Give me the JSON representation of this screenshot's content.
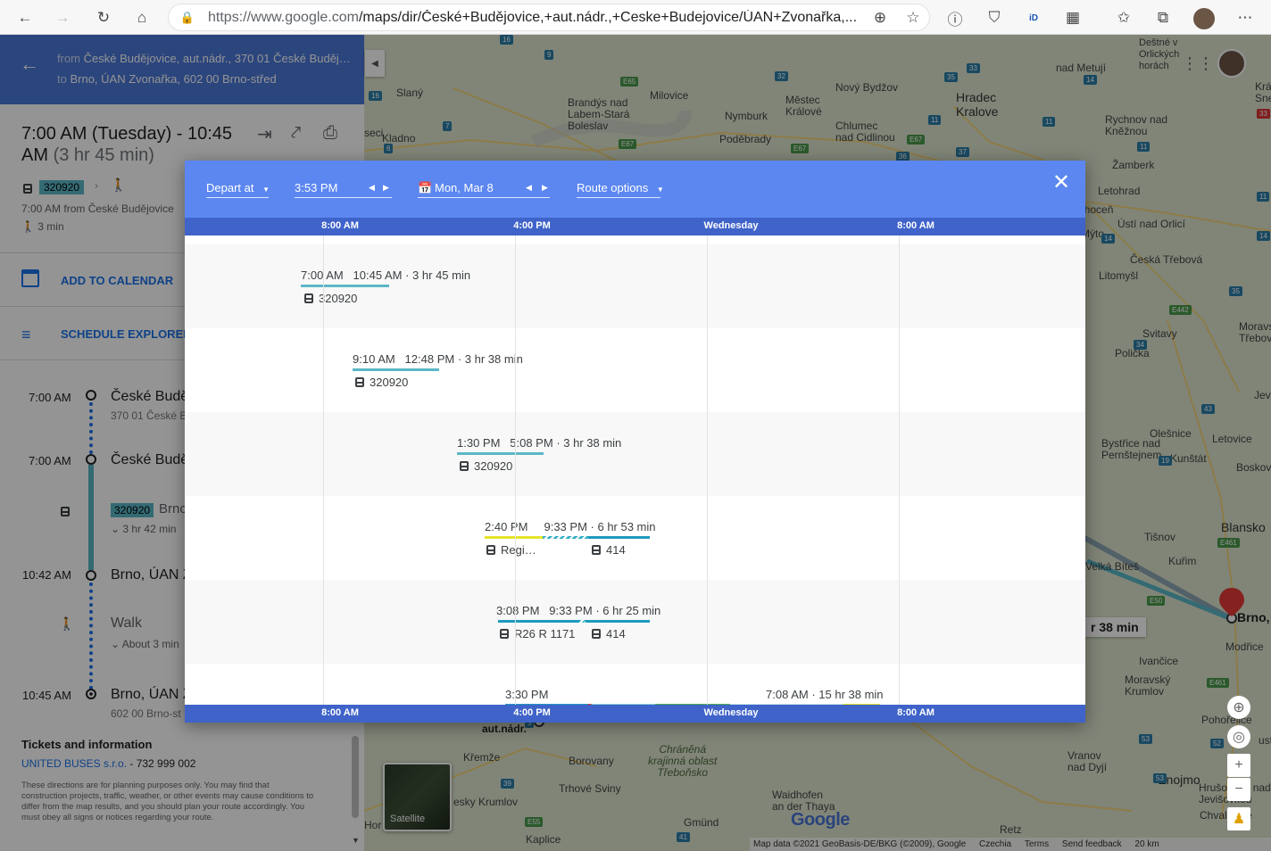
{
  "browser": {
    "url_prefix": "https://www.google.com",
    "url_rest": "/maps/dir/České+Budějovice,+aut.nádr.,+Ceske+Budejovice/ÚAN+Zvonařka,..."
  },
  "sidebar": {
    "from_label": "from",
    "from_value": "České Budějovice, aut.nádr., 370 01 České Buděj…",
    "to_label": "to",
    "to_value": "Brno, ÚAN Zvonařka, 602 00 Brno-střed",
    "trip_time_main": "7:00 AM (Tuesday) - 10:45",
    "trip_time_line2": "AM",
    "trip_duration": "(3 hr 45 min)",
    "route_badge": "320920",
    "depart_summary": "7:00 AM from České Budějovice",
    "walk_summary": "3 min",
    "add_calendar": "ADD TO CALENDAR",
    "schedule_explorer": "SCHEDULE EXPLORER",
    "steps": [
      {
        "time": "7:00 AM",
        "place": "České Budě",
        "sub": "370 01 České B"
      },
      {
        "time": "7:00 AM",
        "place": "České Budě"
      },
      {
        "badge": "320920",
        "dest": "Brno",
        "duration": "3 hr 42 min"
      },
      {
        "time": "10:42 AM",
        "place": "Brno, ÚAN Z"
      },
      {
        "walk": "Walk",
        "about": "About 3 min"
      },
      {
        "time": "10:45 AM",
        "place": "Brno, ÚAN Z",
        "sub": "602 00 Brno-st"
      }
    ],
    "tickets_title": "Tickets and information",
    "operator": "UNITED BUSES s.r.o.",
    "phone": "- 732 999 002",
    "disclaimer": "These directions are for planning purposes only. You may find that construction projects, traffic, weather, or other events may cause conditions to differ from the map results, and you should plan your route accordingly. You must obey all signs or notices regarding your route."
  },
  "schedule": {
    "depart_at": "Depart at",
    "time": "3:53 PM",
    "date": "Mon, Mar 8",
    "route_options": "Route options",
    "axis_labels": [
      "8:00 AM",
      "4:00 PM",
      "Wednesday",
      "8:00 AM"
    ],
    "trips": [
      {
        "dep": "7:00 AM",
        "arr": "10:45 AM",
        "dur": "· 3 hr 45 min",
        "lines": [
          "320920"
        ]
      },
      {
        "dep": "9:10 AM",
        "arr": "12:48 PM",
        "dur": "· 3 hr 38 min",
        "lines": [
          "320920"
        ]
      },
      {
        "dep": "1:30 PM",
        "arr": "5:08 PM",
        "dur": "· 3 hr 38 min",
        "lines": [
          "320920"
        ]
      },
      {
        "dep": "2:40 PM",
        "arr": "9:33 PM",
        "dur": "· 6 hr 53 min",
        "lines": [
          "Regi…",
          "414"
        ]
      },
      {
        "dep": "3:08 PM",
        "arr": "9:33 PM",
        "dur": "· 6 hr 25 min",
        "lines": [
          "R26 R 1171",
          "414"
        ]
      },
      {
        "dep": "3:30 PM",
        "arr": "7:08 AM",
        "dur": "· 15 hr 38 min",
        "lines": []
      }
    ]
  },
  "map": {
    "satellite": "Satellite",
    "route_label": "r 38 min",
    "footer": [
      "Map data ©2021 GeoBasis-DE/BKG (©2009), Google",
      "Czechia",
      "Terms",
      "Send feedback",
      "20 km"
    ],
    "google": "Google",
    "places": {
      "kladno": "Kladno",
      "slany": "Slaný",
      "milovice": "Milovice",
      "brandys": "Brandýs nad\nLabem-Stará\nBoleslav",
      "nymburk": "Nymburk",
      "podebrady": "Poděbrady",
      "mestec": "Městec\nKrálové",
      "chlumec": "Chlumec\nnad Cidlinou",
      "novy": "Nový Bydžov",
      "hradec": "Hradec\nKralove",
      "rychnov": "Rychnov nad\nKněžnou",
      "zamberk": "Žamberk",
      "letohrad": "Letohrad",
      "chocen": "Choceň",
      "usti": "Ústí nad Orlicí",
      "myto": "Mýto",
      "ceska": "Česká Třebová",
      "litomysl": "Litomyšl",
      "svitavy": "Svitavy",
      "moravska": "Moravská\nTřebová",
      "policka": "Polička",
      "olesnice": "Olešnice",
      "letovice": "Letovice",
      "bystrice": "Bystřice nad\nPernštejnem",
      "kunstat": "Kunštát",
      "boskovice": "Boskovice",
      "blansko": "Blansko",
      "tisnov": "Tišnov",
      "kurim": "Kuřim",
      "bites": "Velká Bíteš",
      "brno": "Brno,",
      "modrice": "Modřice",
      "ivancice": "Ivančice",
      "moravsky": "Moravský\nKrumlov",
      "pohorelice": "Pohořelice",
      "znojmo": "Znojmo",
      "hrusovany": "Hrušovany nad\nJevišovkou",
      "chvalovice": "Chvalovice",
      "vranov": "Vranov\nnad Dyjí",
      "waidhofen": "Waidhofen\nan der Thaya",
      "gmund": "Gmünd",
      "retz": "Retz",
      "kaplice": "Kaplice",
      "krumlov": "esky Krumlov",
      "borovany": "Borovany",
      "trhove": "Trhové Sviny",
      "kremze": "Křemže",
      "trebonsko": "Chráněná\nkrajinná oblast\nTřeboňsko",
      "autnadr": "aut.nádr.",
      "dest": "Deštné v\nOrlických\nhorách",
      "nadmetuji": "nad Metují",
      "kra": "Krá\nSne",
      "jevic": "Jevíč",
      "seci": "seci",
      "hor": "Hor",
      "ust": "ust"
    }
  }
}
